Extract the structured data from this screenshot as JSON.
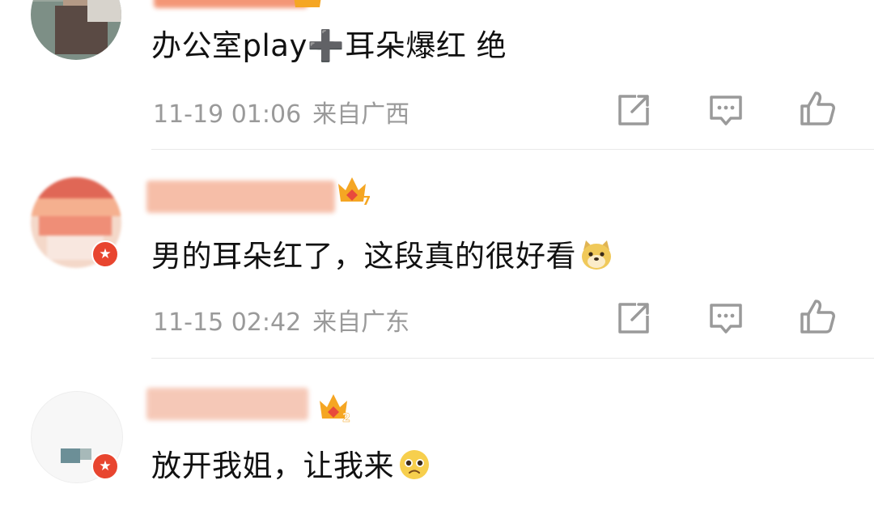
{
  "comments": [
    {
      "text": "办公室play➕耳朵爆红 绝",
      "time": "11-19 01:06",
      "region": "来自广西",
      "name_hidden": true
    },
    {
      "text": "男的耳朵红了，这段真的很好看",
      "time": "11-15 02:42",
      "region": "来自广东",
      "crown_level": "7",
      "emoji": "doge-emoji"
    },
    {
      "text": "放开我姐，让我来",
      "crown_level": "2",
      "emoji": "pleading-face-emoji"
    }
  ],
  "icons": {
    "share": "share-icon",
    "comment": "comment-icon",
    "like": "like-icon",
    "verified": "verified-badge-icon",
    "crown": "crown-icon"
  },
  "colors": {
    "text": "#111111",
    "meta": "#9a9a9a",
    "badge": "#e8452f",
    "crown": "#f5a623",
    "crown_gem": "#e84a3c"
  }
}
